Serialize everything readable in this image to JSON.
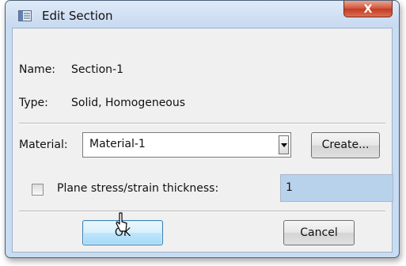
{
  "window": {
    "title": "Edit Section",
    "close_glyph": "X"
  },
  "fields": {
    "name_label": "Name:",
    "name_value": "Section-1",
    "type_label": "Type:",
    "type_value": "Solid, Homogeneous",
    "material_label": "Material:",
    "material_value": "Material-1",
    "create_label": "Create...",
    "plane_label": "Plane stress/strain thickness:",
    "plane_value": "1",
    "plane_checked": false
  },
  "buttons": {
    "ok_label": "OK",
    "cancel_label": "Cancel"
  },
  "colors": {
    "titlebar": "#c8dcf2",
    "close": "#c43b22",
    "input_highlight": "#b9d2ec"
  }
}
